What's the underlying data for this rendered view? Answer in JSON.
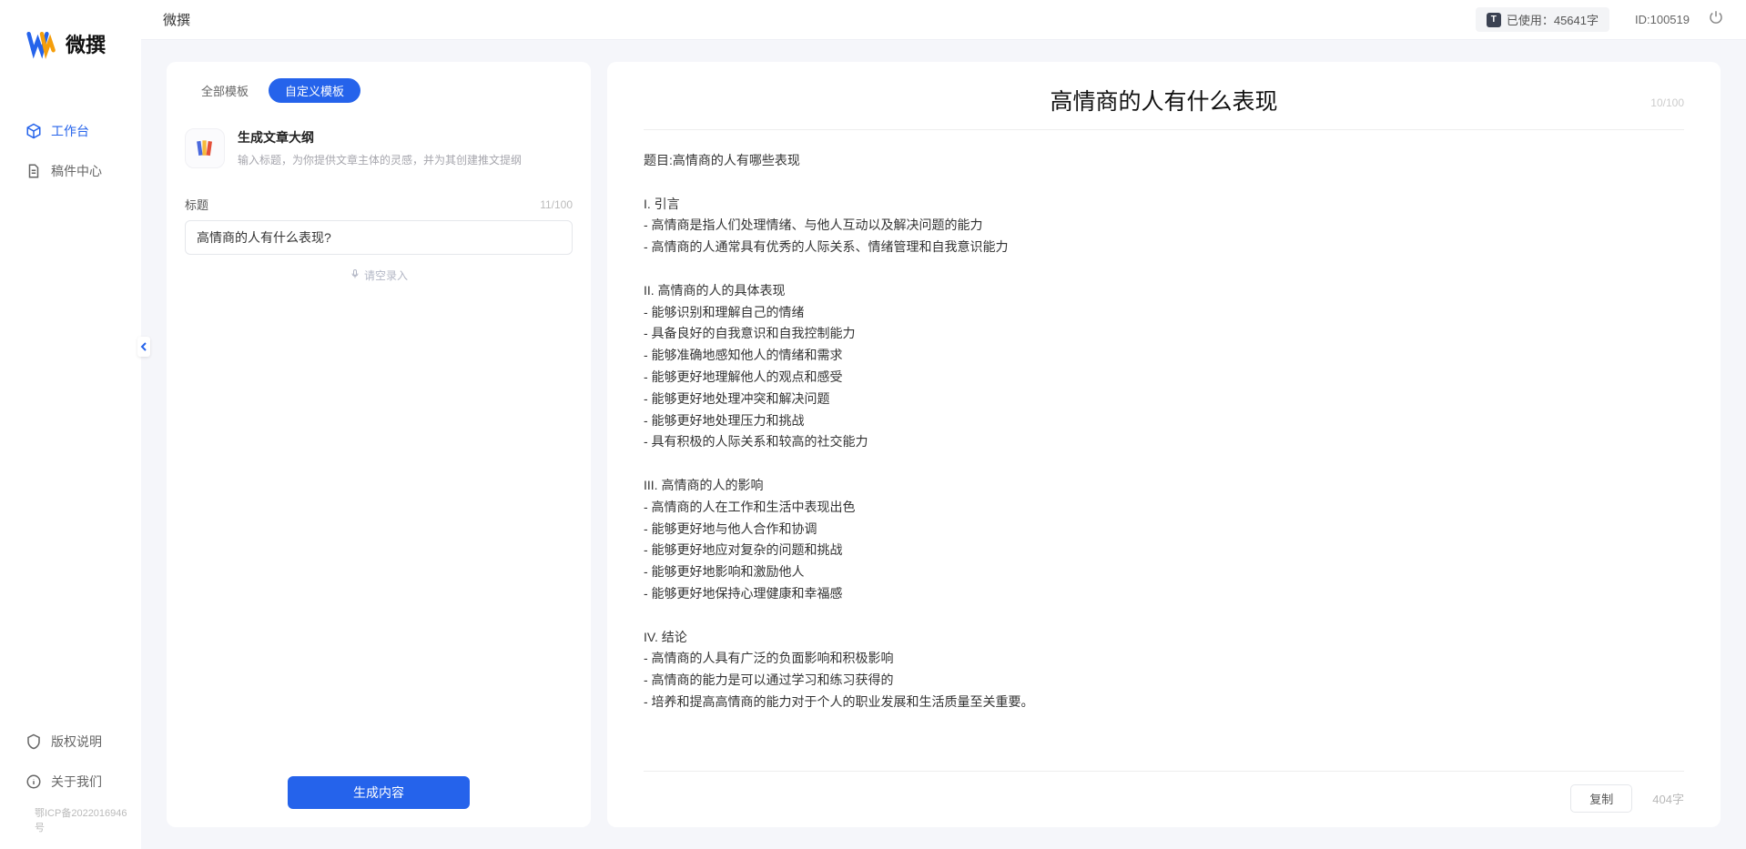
{
  "app": {
    "logo_text": "微撰",
    "header_title": "微撰"
  },
  "sidebar": {
    "nav": [
      {
        "label": "工作台"
      },
      {
        "label": "稿件中心"
      }
    ],
    "bottom": [
      {
        "label": "版权说明"
      },
      {
        "label": "关于我们"
      }
    ],
    "icp": "鄂ICP备2022016946号"
  },
  "header": {
    "usage_label": "已使用：45641字",
    "id_label": "ID:100519"
  },
  "tabs": {
    "all": "全部模板",
    "custom": "自定义模板"
  },
  "template_card": {
    "title": "生成文章大纲",
    "desc": "输入标题，为你提供文章主体的灵感，并为其创建推文提纲"
  },
  "form": {
    "title_label": "标题",
    "title_counter": "11/100",
    "title_value": "高情商的人有什么表现?",
    "voice_hint": "请空录入",
    "generate_btn": "生成内容"
  },
  "output": {
    "title": "高情商的人有什么表现",
    "title_counter": "10/100",
    "body": "题目:高情商的人有哪些表现\n\nI. 引言\n- 高情商是指人们处理情绪、与他人互动以及解决问题的能力\n- 高情商的人通常具有优秀的人际关系、情绪管理和自我意识能力\n\nII. 高情商的人的具体表现\n- 能够识别和理解自己的情绪\n- 具备良好的自我意识和自我控制能力\n- 能够准确地感知他人的情绪和需求\n- 能够更好地理解他人的观点和感受\n- 能够更好地处理冲突和解决问题\n- 能够更好地处理压力和挑战\n- 具有积极的人际关系和较高的社交能力\n\nIII. 高情商的人的影响\n- 高情商的人在工作和生活中表现出色\n- 能够更好地与他人合作和协调\n- 能够更好地应对复杂的问题和挑战\n- 能够更好地影响和激励他人\n- 能够更好地保持心理健康和幸福感\n\nIV. 结论\n- 高情商的人具有广泛的负面影响和积极影响\n- 高情商的能力是可以通过学习和练习获得的\n- 培养和提高高情商的能力对于个人的职业发展和生活质量至关重要。",
    "copy_btn": "复制",
    "word_count": "404字"
  }
}
